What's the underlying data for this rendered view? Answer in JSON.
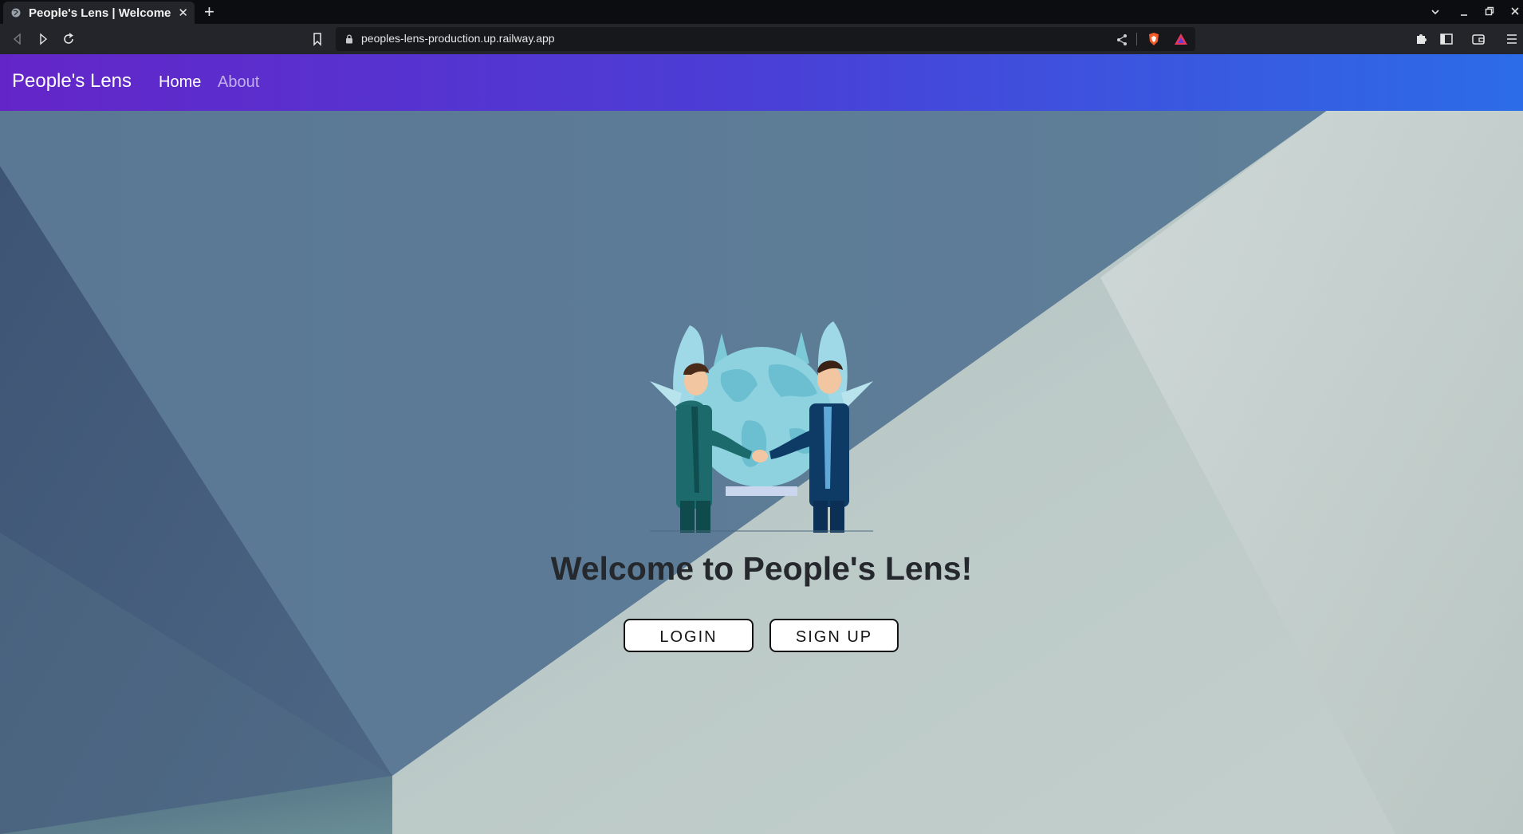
{
  "browser": {
    "tab_title": "People's Lens | Welcome",
    "tab_close": "✕",
    "new_tab": "+",
    "url": "peoples-lens-production.up.railway.app"
  },
  "navbar": {
    "brand": "People's Lens",
    "links": [
      "Home",
      "About"
    ]
  },
  "hero": {
    "heading": "Welcome to People's Lens!",
    "login_label": "LOGIN",
    "signup_label": "SIGN UP"
  },
  "colors": {
    "navbar_gradient": [
      "#6425c8",
      "#2c6ce8"
    ],
    "background_dark": "#5a7898",
    "background_light": "#c9d4d3"
  }
}
